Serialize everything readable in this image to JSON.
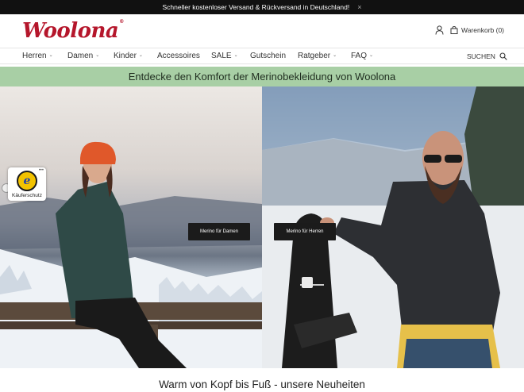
{
  "topbar": {
    "message": "Schneller kostenloser Versand & Rückversand in Deutschland!",
    "close": "×"
  },
  "header": {
    "logo_text": "Woolona",
    "logo_mark": "®",
    "cart_label": "Warenkorb (0)"
  },
  "nav": {
    "items": [
      {
        "label": "Herren",
        "chevron": "⌄"
      },
      {
        "label": "Damen",
        "chevron": "⌄"
      },
      {
        "label": "Kinder",
        "chevron": "⌄"
      },
      {
        "label": "Accessoires",
        "chevron": ""
      },
      {
        "label": "SALE",
        "chevron": "⌄"
      },
      {
        "label": "Gutschein",
        "chevron": ""
      },
      {
        "label": "Ratgeber",
        "chevron": "⌄"
      },
      {
        "label": "FAQ",
        "chevron": "⌄"
      }
    ],
    "search_label": "SUCHEN"
  },
  "banner": {
    "text": "Entdecke den Komfort der Merinobekleidung von Woolona"
  },
  "hero": {
    "left_button": "Merino für Damen",
    "right_button": "Merino für Herren"
  },
  "trust_badge": {
    "letter": "e",
    "label": "Käuferschutz",
    "dots": "•••"
  },
  "section": {
    "title": "Warm von Kopf bis Fuß - unsere Neuheiten"
  },
  "colors": {
    "brand": "#b5162b",
    "banner_bg": "#a8cfa5",
    "topbar_bg": "#111111",
    "button_bg": "#1b1b1b"
  },
  "icons": {
    "user": "user-icon",
    "cart": "cart-icon",
    "search": "search-icon"
  }
}
